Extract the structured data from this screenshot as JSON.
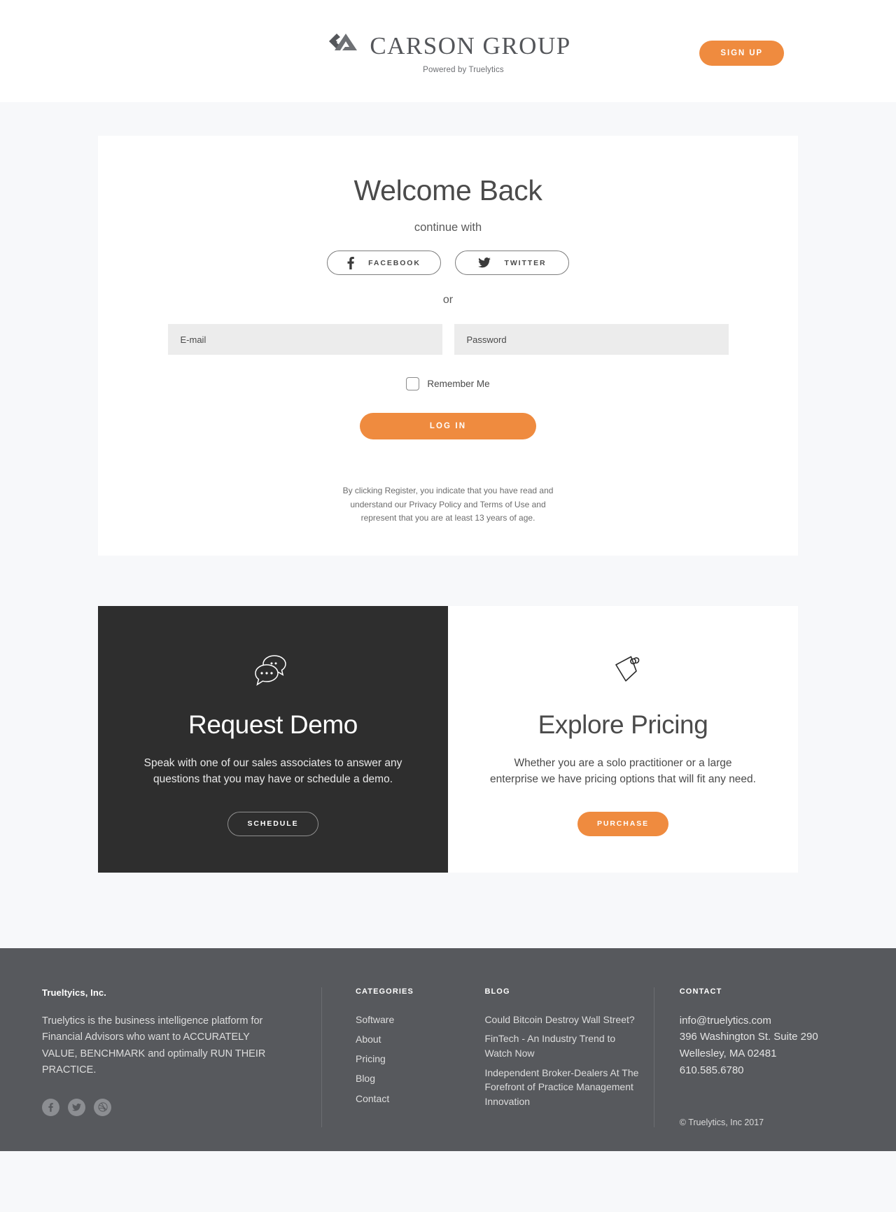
{
  "colors": {
    "accent": "#ef8b3f",
    "dark_card": "#2e2e2e",
    "footer_bg": "#57595d",
    "page_bg": "#f7f8fa",
    "field_bg": "#ececec"
  },
  "header": {
    "logo_word": "CARSON GROUP",
    "logo_subtitle": "Powered by Truelytics",
    "signup_label": "SIGN UP"
  },
  "login": {
    "title": "Welcome Back",
    "continue_with": "continue with",
    "facebook_label": "FACEBOOK",
    "twitter_label": "TWITTER",
    "or": "or",
    "email_placeholder": "E-mail",
    "email_value": "",
    "password_placeholder": "Password",
    "password_value": "",
    "remember_label": "Remember Me",
    "remember_checked": false,
    "login_label": "LOG IN",
    "legal": "By clicking Register, you indicate that you have read and understand our Privacy Policy and Terms of Use and represent that you are at least 13 years of age."
  },
  "promos": [
    {
      "icon": "chat-bubbles-icon",
      "title": "Request Demo",
      "text": "Speak with one of our sales associates to answer any questions that you may have or schedule a demo.",
      "button_label": "SCHEDULE",
      "style": "dark"
    },
    {
      "icon": "price-tag-icon",
      "title": "Explore Pricing",
      "text": "Whether you are a solo practitioner or a large enterprise we have pricing options that will fit any need.",
      "button_label": "PURCHASE",
      "style": "light"
    }
  ],
  "footer": {
    "brand": "Trueltyics, Inc.",
    "about": "Truelytics is the business intelligence platform for Financial Advisors who want to ACCURATELY VALUE, BENCHMARK and optimally RUN THEIR PRACTICE.",
    "social": [
      {
        "name": "facebook-icon"
      },
      {
        "name": "twitter-icon"
      },
      {
        "name": "dribbble-icon"
      }
    ],
    "categories_heading": "CATEGORIES",
    "categories": [
      "Software",
      "About",
      "Pricing",
      "Blog",
      "Contact"
    ],
    "blog_heading": "BLOG",
    "blog_posts": [
      "Could Bitcoin Destroy Wall Street?",
      "FinTech - An Industry Trend to Watch Now",
      "Independent Broker-Dealers At The Forefront of Practice Management Innovation"
    ],
    "contact_heading": "CONTACT",
    "contact_email": "info@truelytics.com",
    "contact_address1": "396 Washington St. Suite 290",
    "contact_address2": "Wellesley, MA 02481",
    "contact_phone": " 610.585.6780",
    "copyright": "© Truelytics, Inc  2017"
  }
}
